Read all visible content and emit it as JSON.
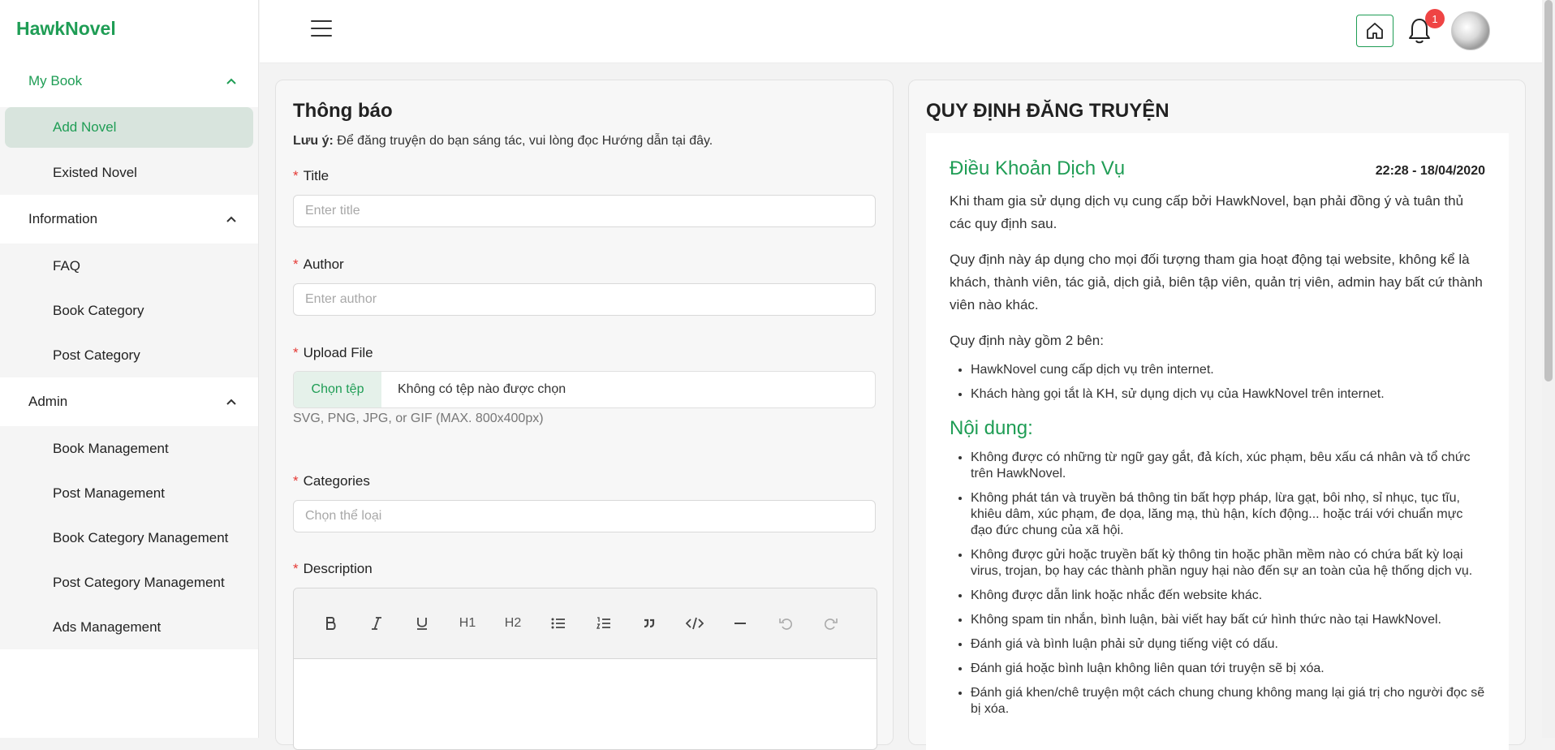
{
  "brand": "HawkNovel",
  "sidebar": {
    "groups": [
      {
        "label": "My Book",
        "items": [
          "Add Novel",
          "Existed Novel"
        ]
      },
      {
        "label": "Information",
        "items": [
          "FAQ",
          "Book Category",
          "Post Category"
        ]
      },
      {
        "label": "Admin",
        "items": [
          "Book Management",
          "Post Management",
          "Book Category Management",
          "Post Category Management",
          "Ads Management"
        ]
      }
    ]
  },
  "header": {
    "notification_count": "1"
  },
  "form": {
    "title": "Thông báo",
    "note_bold": "Lưu ý:",
    "note_text": " Để đăng truyện do bạn sáng tác, vui lòng đọc Hướng dẫn tại đây.",
    "required_mark": "*",
    "title_label": "Title",
    "title_placeholder": "Enter title",
    "author_label": "Author",
    "author_placeholder": "Enter author",
    "upload_label": "Upload File",
    "file_button": "Chọn tệp",
    "file_status": "Không có tệp nào được chọn",
    "file_hint": "SVG, PNG, JPG, or GIF (MAX. 800x400px)",
    "categories_label": "Categories",
    "categories_placeholder": "Chọn thể loại",
    "description_label": "Description",
    "toolbar": {
      "h1": "H1",
      "h2": "H2"
    }
  },
  "rules": {
    "title": "QUY ĐỊNH ĐĂNG TRUYỆN",
    "terms_title": "Điều Khoản Dịch Vụ",
    "terms_date": "22:28 - 18/04/2020",
    "p1": "Khi tham gia sử dụng dịch vụ cung cấp bởi HawkNovel, bạn phải đồng ý và tuân thủ các quy định sau.",
    "p2": "Quy định này áp dụng cho mọi đối tượng tham gia hoạt động tại website, không kể là khách, thành viên, tác giả, dịch giả, biên tập viên, quản trị viên, admin hay bất cứ thành viên nào khác.",
    "p3": "Quy định này gồm 2 bên:",
    "parties": [
      "HawkNovel cung cấp dịch vụ trên internet.",
      "Khách hàng gọi tắt là KH, sử dụng dịch vụ của HawkNovel trên internet."
    ],
    "content_title": "Nội dung:",
    "content_items": [
      "Không được có những từ ngữ gay gắt, đả kích, xúc phạm, bêu xấu cá nhân và tổ chức trên HawkNovel.",
      "Không phát tán và truyền bá thông tin bất hợp pháp, lừa gạt, bôi nhọ, sỉ nhục, tục tĩu, khiêu dâm, xúc phạm, đe dọa, lăng mạ, thù hận, kích động... hoặc trái với chuẩn mực đạo đức chung của xã hội.",
      "Không được gửi hoặc truyền bất kỳ thông tin hoặc phần mềm nào có chứa bất kỳ loại virus, trojan, bọ hay các thành phần nguy hại nào đến sự an toàn của hệ thống dịch vụ.",
      "Không được dẫn link hoặc nhắc đến website khác.",
      "Không spam tin nhắn, bình luận, bài viết hay bất cứ hình thức nào tại HawkNovel.",
      "Đánh giá và bình luận phải sử dụng tiếng việt có dấu.",
      "Đánh giá hoặc bình luận không liên quan tới truyện sẽ bị xóa.",
      "Đánh giá khen/chê truyện một cách chung chung không mang lại giá trị cho người đọc sẽ bị xóa."
    ]
  },
  "colors": {
    "accent": "#1f9d55",
    "badge": "#ef4444"
  }
}
